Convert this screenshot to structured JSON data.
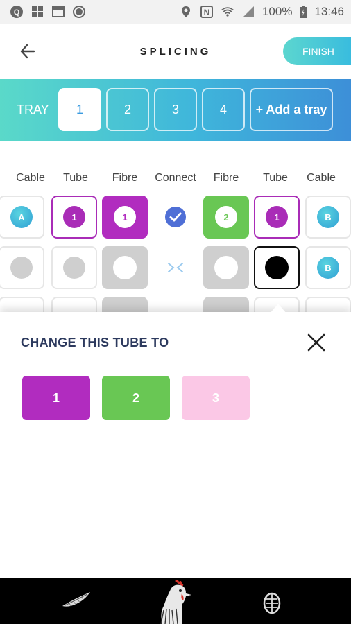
{
  "status_bar": {
    "battery": "100%",
    "time": "13:46"
  },
  "header": {
    "title": "SPLICING",
    "finish_label": "FINISH"
  },
  "tray_bar": {
    "label": "TRAY",
    "trays": [
      "1",
      "2",
      "3",
      "4"
    ],
    "active_tray": "1",
    "add_label": "+ Add a tray"
  },
  "columns": [
    "Cable",
    "Tube",
    "Fibre",
    "Connect",
    "Fibre",
    "Tube",
    "Cable"
  ],
  "rows": [
    {
      "left_cable": "A",
      "left_tube": "1",
      "left_fibre": "1",
      "connected": true,
      "right_fibre": "2",
      "right_tube": "1",
      "right_cable": "B"
    },
    {
      "left_cable": "",
      "left_tube": "",
      "left_fibre": "",
      "connected": false,
      "right_fibre": "",
      "right_tube": "",
      "right_cable": "B"
    }
  ],
  "sheet": {
    "title": "CHANGE THIS TUBE TO",
    "options": [
      {
        "label": "1",
        "color": "#b12cbf"
      },
      {
        "label": "2",
        "color": "#69c754"
      },
      {
        "label": "3",
        "color": "#fbc8e6"
      }
    ]
  },
  "colors": {
    "accent_purple": "#b12cbf",
    "accent_green": "#69c754",
    "accent_teal": "#4fcfd0",
    "cable_blue": "#2f9fd4",
    "sheet_title": "#2d3a5e"
  },
  "nav": {
    "icons": [
      "feather-icon",
      "rooster-icon",
      "footprint-icon"
    ]
  }
}
